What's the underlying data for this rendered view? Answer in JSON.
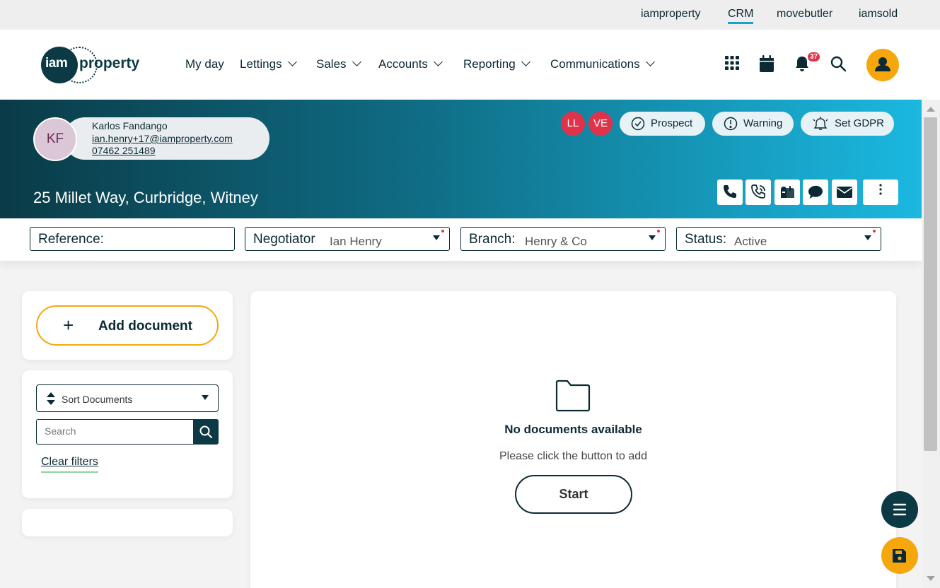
{
  "topbar": {
    "links": [
      "iamproperty",
      "CRM",
      "movebutler",
      "iamsold"
    ],
    "active": "CRM"
  },
  "logo": {
    "iam": "iam",
    "property": "property"
  },
  "nav": {
    "items": [
      "My day",
      "Lettings",
      "Sales",
      "Accounts",
      "Reporting",
      "Communications"
    ]
  },
  "header_icons": [
    "apps-grid-icon",
    "calendar-icon",
    "bell-icon",
    "search-icon",
    "user-icon"
  ],
  "notifications": {
    "count": "37"
  },
  "contact": {
    "initials": "KF",
    "name": "Karlos Fandango",
    "email": "ian.henry+17@iamproperty.com",
    "phone": "07462 251489",
    "tags": [
      "LL",
      "VE"
    ]
  },
  "status_buttons": {
    "prospect": "Prospect",
    "warning": "Warning",
    "gdpr": "Set GDPR"
  },
  "property": {
    "address": "25 Millet Way, Curbridge, Witney"
  },
  "action_icons": [
    "phone-icon",
    "phone-call-icon",
    "voicemail-icon",
    "chat-icon",
    "email-icon",
    "more-options-icon"
  ],
  "filters": {
    "reference": {
      "label": "Reference:",
      "value": ""
    },
    "negotiator": {
      "label": "Negotiator",
      "value": "Ian Henry"
    },
    "branch": {
      "label": "Branch:",
      "value": "Henry & Co"
    },
    "status": {
      "label": "Status:",
      "value": "Active"
    }
  },
  "documents": {
    "add_label": "Add document",
    "sort_label": "Sort Documents",
    "search_placeholder": "Search",
    "clear_filters": "Clear filters",
    "empty_title": "No documents available",
    "empty_subtitle": "Please click the button to add",
    "start_label": "Start"
  },
  "colors": {
    "brand_dark": "#0b3a45",
    "accent_orange": "#f6a70e",
    "tag_red": "#e0334a",
    "banner_gradient_end": "#1bb8e0"
  }
}
